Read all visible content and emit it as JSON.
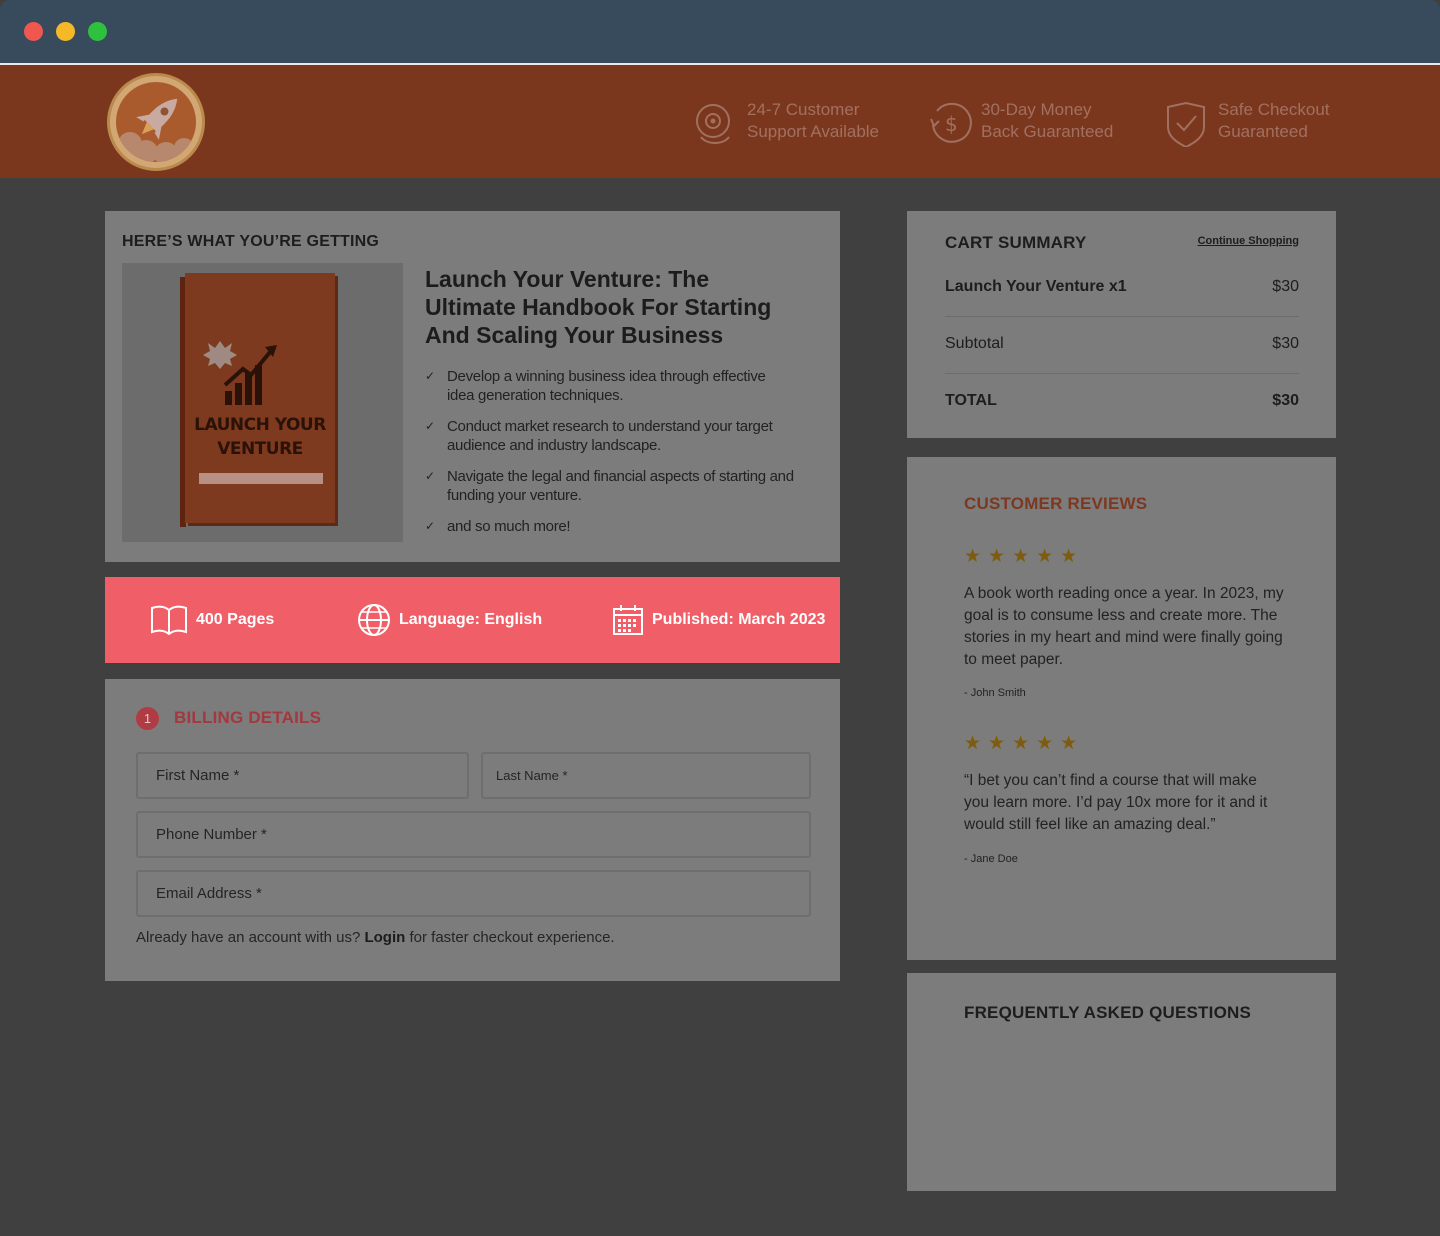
{
  "header": {
    "guarantees": [
      {
        "icon": "headset-icon",
        "line1": "24-7 Customer",
        "line2": "Support Available"
      },
      {
        "icon": "money-back-icon",
        "line1": "30-Day Money",
        "line2": "Back Guaranteed"
      },
      {
        "icon": "shield-check-icon",
        "line1": "Safe Checkout",
        "line2": "Guaranteed"
      }
    ]
  },
  "product": {
    "kicker": "HERE’S WHAT YOU’RE GETTING",
    "cover_title_line1": "LAUNCH YOUR",
    "cover_title_line2": "VENTURE",
    "title": "Launch Your Venture: The Ultimate Handbook For Starting And Scaling Your Business",
    "benefits": [
      "Develop a winning business idea through effective idea generation techniques.",
      "Conduct market research to understand your target audience and industry landscape.",
      "Navigate the legal and financial aspects of starting and funding your venture.",
      "and so much more!"
    ]
  },
  "meta": {
    "pages": "400 Pages",
    "language": "Language: English",
    "published": "Published: March 2023"
  },
  "billing": {
    "step": "1",
    "title": "BILLING DETAILS",
    "first_name": "First Name *",
    "last_name": "Last Name *",
    "phone": "Phone Number *",
    "email": "Email Address *",
    "note_before": "Already have an account with us?",
    "login_link": "Login",
    "note_after": "for faster checkout experience."
  },
  "cart": {
    "title": "CART SUMMARY",
    "continue": "Continue Shopping",
    "item_label": "Launch Your Venture x1",
    "item_price": "$30",
    "subtotal_label": "Subtotal",
    "subtotal_value": "$30",
    "total_label": "TOTAL",
    "total_value": "$30"
  },
  "reviews": {
    "title": "CUSTOMER REVIEWS",
    "items": [
      {
        "stars": "★★★★★",
        "text": "A book worth reading once a year. In 2023, my goal is to consume less and create more. The stories in my heart and mind were finally going to meet paper.",
        "author": "- John Smith"
      },
      {
        "stars": "★★★★★",
        "text": "“I bet you can’t find a course that will make you learn more. I’d pay 10x more for it and it would still feel like an amazing deal.”",
        "author": "- Jane Doe"
      }
    ]
  },
  "faq": {
    "title": "FREQUENTLY ASKED QUESTIONS"
  }
}
